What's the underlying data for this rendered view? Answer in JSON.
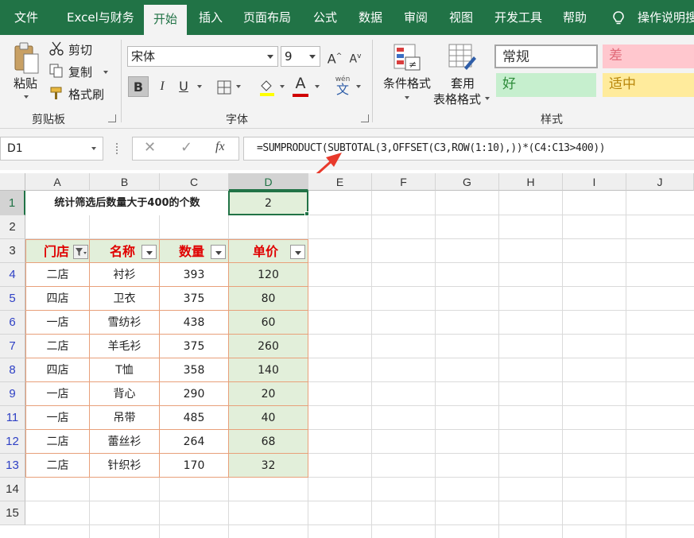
{
  "ribbon_tabs": [
    "文件",
    "Excel与财务",
    "开始",
    "插入",
    "页面布局",
    "公式",
    "数据",
    "审阅",
    "视图",
    "开发工具",
    "帮助"
  ],
  "tell_me": "操作说明搜",
  "clipboard": {
    "paste": "粘贴",
    "cut": "剪切",
    "copy": "复制",
    "format_painter": "格式刷",
    "group_label": "剪贴板"
  },
  "font": {
    "name": "宋体",
    "size": "9",
    "bold": "B",
    "italic": "I",
    "underline": "U",
    "grow": "A",
    "shrink": "A",
    "font_color_glyph": "A",
    "wen_pinyin": "wén",
    "wen_char": "文",
    "group_label": "字体"
  },
  "styles": {
    "conditional_format": "条件格式",
    "table_format_1": "套用",
    "table_format_2": "表格格式",
    "normal": "常规",
    "bad": "差",
    "good": "好",
    "neutral": "适中",
    "group_label": "样式"
  },
  "name_box": "D1",
  "formula": "=SUMPRODUCT(SUBTOTAL(3,OFFSET(C3,ROW(1:10),))*(C4:C13>400))",
  "columns": [
    "A",
    "B",
    "C",
    "D",
    "E",
    "F",
    "G",
    "H",
    "I",
    "J"
  ],
  "row_numbers": [
    "1",
    "2",
    "3",
    "4",
    "5",
    "6",
    "7",
    "8",
    "9",
    "11",
    "12",
    "13",
    "14",
    "15"
  ],
  "cells": {
    "a1": "统计筛选后数量大于400的个数",
    "d1": "2"
  },
  "table": {
    "headers": [
      "门店",
      "名称",
      "数量",
      "单价"
    ],
    "rows": [
      [
        "二店",
        "衬衫",
        "393",
        "120"
      ],
      [
        "四店",
        "卫衣",
        "375",
        "80"
      ],
      [
        "一店",
        "雪纺衫",
        "438",
        "60"
      ],
      [
        "二店",
        "羊毛衫",
        "375",
        "260"
      ],
      [
        "四店",
        "T恤",
        "358",
        "140"
      ],
      [
        "一店",
        "背心",
        "290",
        "20"
      ],
      [
        "一店",
        "吊带",
        "485",
        "40"
      ],
      [
        "二店",
        "蕾丝衫",
        "264",
        "68"
      ],
      [
        "二店",
        "针织衫",
        "170",
        "32"
      ]
    ]
  },
  "colors": {
    "excel_green": "#217346",
    "header_fill": "#e2efda",
    "header_text": "#e00000",
    "table_border": "#e8a07a",
    "arrow": "#e8392b",
    "bad_fill": "#ffc7ce",
    "good_fill": "#c6efce",
    "neutral_fill": "#ffeb9c"
  }
}
